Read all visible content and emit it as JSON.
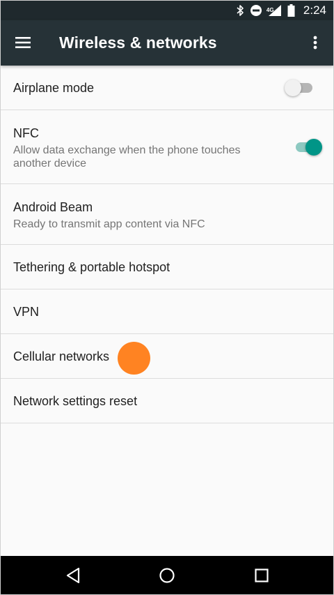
{
  "status_bar": {
    "network_label": "4G",
    "time": "2:24",
    "icons": [
      "bluetooth-icon",
      "do-not-disturb-icon",
      "signal-icon",
      "battery-icon"
    ]
  },
  "app_bar": {
    "title": "Wireless & networks",
    "background": "#263237"
  },
  "settings": [
    {
      "title": "Airplane mode",
      "summary": "",
      "toggle": "off"
    },
    {
      "title": "NFC",
      "summary": "Allow data exchange when the phone touches another device",
      "toggle": "on"
    },
    {
      "title": "Android Beam",
      "summary": "Ready to transmit app content via NFC"
    },
    {
      "title": "Tethering & portable hotspot",
      "summary": ""
    },
    {
      "title": "VPN",
      "summary": ""
    },
    {
      "title": "Cellular networks",
      "summary": ""
    },
    {
      "title": "Network settings reset",
      "summary": ""
    }
  ],
  "colors": {
    "accent": "#009587",
    "touch_indicator": "#ff8322"
  },
  "nav_bar": {
    "buttons": [
      "back-icon",
      "home-icon",
      "recents-icon"
    ]
  }
}
